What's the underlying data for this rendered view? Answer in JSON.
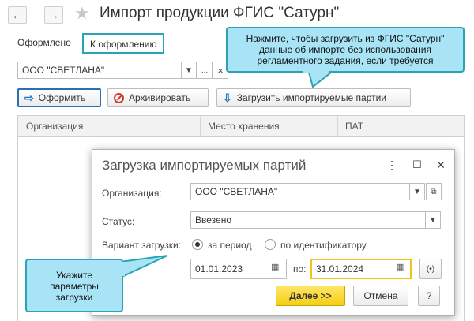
{
  "window": {
    "title": "Импорт продукции ФГИС \"Сатурн\"",
    "back_icon": "←",
    "forward_icon": "→",
    "star_icon": "★"
  },
  "tabs": [
    {
      "label": "Оформлено"
    },
    {
      "label": "К оформлению"
    }
  ],
  "filter": {
    "organization": "ООО \"СВЕТЛАНА\"",
    "more_label": "...",
    "clear_label": "×"
  },
  "toolbar": {
    "issue_label": "Оформить",
    "archive_label": "Архивировать",
    "load_label": "Загрузить импортируемые партии"
  },
  "table": {
    "columns": [
      "Организация",
      "Место хранения",
      "ПАТ"
    ]
  },
  "callouts": {
    "top_lines": [
      "Нажмите, чтобы загрузить из ФГИС \"Сатурн\"",
      "данные об импорте без использования",
      "регламентного задания, если требуется"
    ],
    "bottom_lines": [
      "Укажите",
      "параметры",
      "загрузки"
    ]
  },
  "dialog": {
    "title": "Загрузка импортируемых партий",
    "org_label": "Организация:",
    "org_value": "ООО \"СВЕТЛАНА\"",
    "status_label": "Статус:",
    "status_value": "Ввезено",
    "variant_label": "Вариант загрузки:",
    "variant_options": [
      "за период",
      "по идентификатору"
    ],
    "date_from": "01.01.2023",
    "to_label": "по:",
    "date_to": "31.01.2024",
    "next_label": "Далее >>",
    "cancel_label": "Отмена",
    "help_label": "?",
    "menu_icon": "⋮",
    "maximize_icon": "☐",
    "close_icon": "✕"
  },
  "colors": {
    "accent": "#2aa4b4",
    "callout_fill": "#a8e4f5",
    "primary_button": "#f5cf14",
    "date_highlight": "#f0c419"
  }
}
